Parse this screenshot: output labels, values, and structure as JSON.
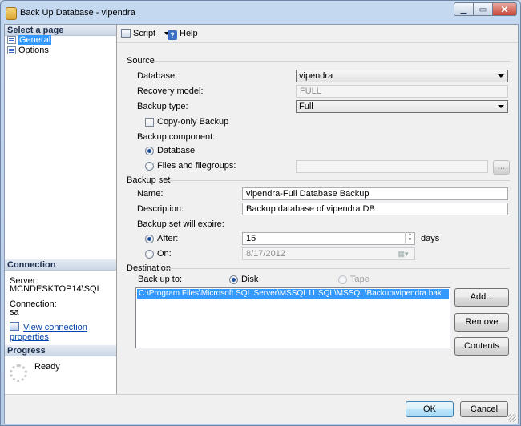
{
  "window": {
    "title": "Back Up Database - vipendra",
    "min_icon": "minimize-icon",
    "max_icon": "maximize-icon",
    "close_icon": "close-icon"
  },
  "left_pane": {
    "select_page_header": "Select a page",
    "pages": [
      {
        "label": "General",
        "selected": true
      },
      {
        "label": "Options",
        "selected": false
      }
    ],
    "connection_header": "Connection",
    "server_label": "Server:",
    "server_value": "MCNDESKTOP14\\SQL",
    "connection_label": "Connection:",
    "connection_value": "sa",
    "view_connection_link": "View connection properties",
    "progress_header": "Progress",
    "progress_status": "Ready"
  },
  "toolbar": {
    "script_label": "Script",
    "help_label": "Help"
  },
  "source": {
    "group_label": "Source",
    "database_label": "Database:",
    "database_value": "vipendra",
    "recovery_label": "Recovery model:",
    "recovery_value": "FULL",
    "backup_type_label": "Backup type:",
    "backup_type_value": "Full",
    "copy_only_label": "Copy-only Backup",
    "copy_only_checked": false,
    "component_label": "Backup component:",
    "component_database": "Database",
    "component_files": "Files and filegroups:",
    "component_selected": "Database",
    "files_browse": "..."
  },
  "backup_set": {
    "group_label": "Backup set",
    "name_label": "Name:",
    "name_value": "vipendra-Full Database Backup",
    "description_label": "Description:",
    "description_value": "Backup database of vipendra DB",
    "expire_label": "Backup set will expire:",
    "after_label": "After:",
    "after_value": "15",
    "days_label": "days",
    "on_label": "On:",
    "on_value": "8/17/2012",
    "expire_selected": "After"
  },
  "destination": {
    "group_label": "Destination",
    "back_up_to_label": "Back up to:",
    "disk_label": "Disk",
    "tape_label": "Tape",
    "selected": "Disk",
    "paths": [
      "C:\\Program Files\\Microsoft SQL Server\\MSSQL11.SQL\\MSSQL\\Backup\\vipendra.bak"
    ],
    "add_button": "Add...",
    "remove_button": "Remove",
    "contents_button": "Contents"
  },
  "footer": {
    "ok_button": "OK",
    "cancel_button": "Cancel"
  }
}
